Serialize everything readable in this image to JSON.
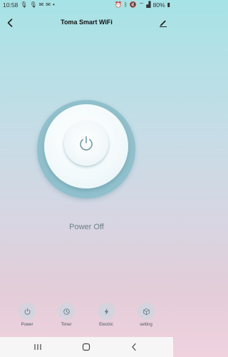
{
  "status_bar": {
    "time": "10:58",
    "battery": "80%"
  },
  "app_bar": {
    "title": "Toma Smart WiFi"
  },
  "device": {
    "status": "Power Off"
  },
  "bottom_nav": {
    "items": [
      {
        "label": "Power",
        "icon": "power-icon"
      },
      {
        "label": "Timer",
        "icon": "timer-icon"
      },
      {
        "label": "Electric",
        "icon": "lightning-icon"
      },
      {
        "label": "setting",
        "icon": "cube-icon"
      }
    ]
  },
  "colors": {
    "accent": "#7fb3c1",
    "icon": "#6f9aa8"
  }
}
